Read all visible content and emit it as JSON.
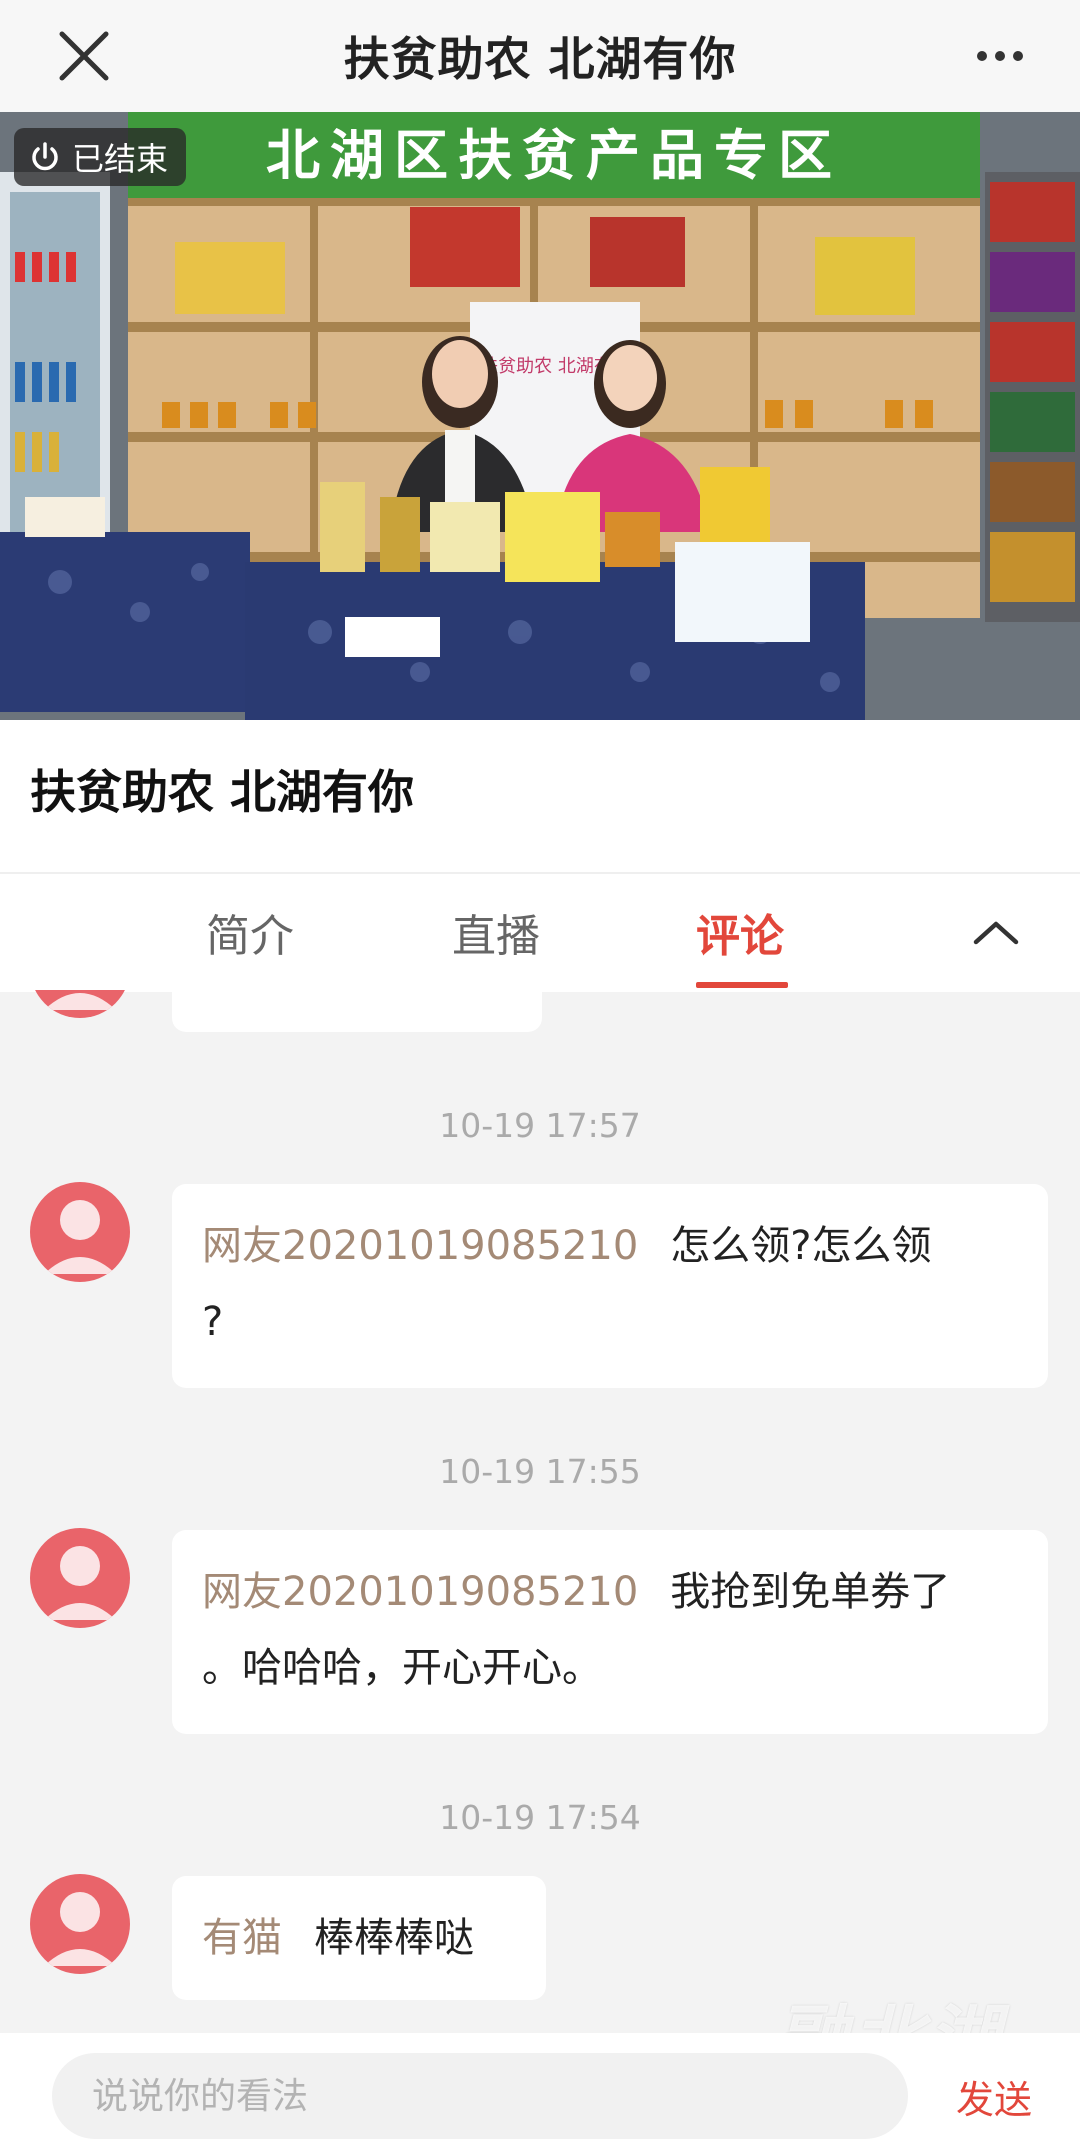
{
  "header": {
    "title": "扶贫助农 北湖有你"
  },
  "video": {
    "status_badge": "已结束",
    "banner_text": "北湖区扶贫产品专区",
    "backdrop_text": "扶贫助农 北湖有你"
  },
  "live": {
    "title": "扶贫助农 北湖有你"
  },
  "tabs": [
    {
      "label": "简介",
      "active": false
    },
    {
      "label": "直播",
      "active": false
    },
    {
      "label": "评论",
      "active": true
    }
  ],
  "comments": [
    {
      "nickname": "",
      "text": "",
      "partial": true
    },
    {
      "time": "10-19 17:57",
      "nickname": "网友20201019085210",
      "text_line1": "怎么领?怎么领",
      "text_line2": "?"
    },
    {
      "time": "10-19 17:55",
      "nickname": "网友20201019085210",
      "text_line1": "我抢到免单券了",
      "text_line2": "。哈哈哈，开心开心。"
    },
    {
      "time": "10-19 17:54",
      "nickname": "有猫",
      "text_line1": "棒棒棒哒"
    }
  ],
  "composer": {
    "placeholder": "说说你的看法",
    "send_label": "发送"
  },
  "watermark": "融北湖",
  "colors": {
    "accent": "#e2473b",
    "avatar": "#e9646a",
    "nickname": "#a48a76",
    "banner_green": "#3f9a3c"
  }
}
